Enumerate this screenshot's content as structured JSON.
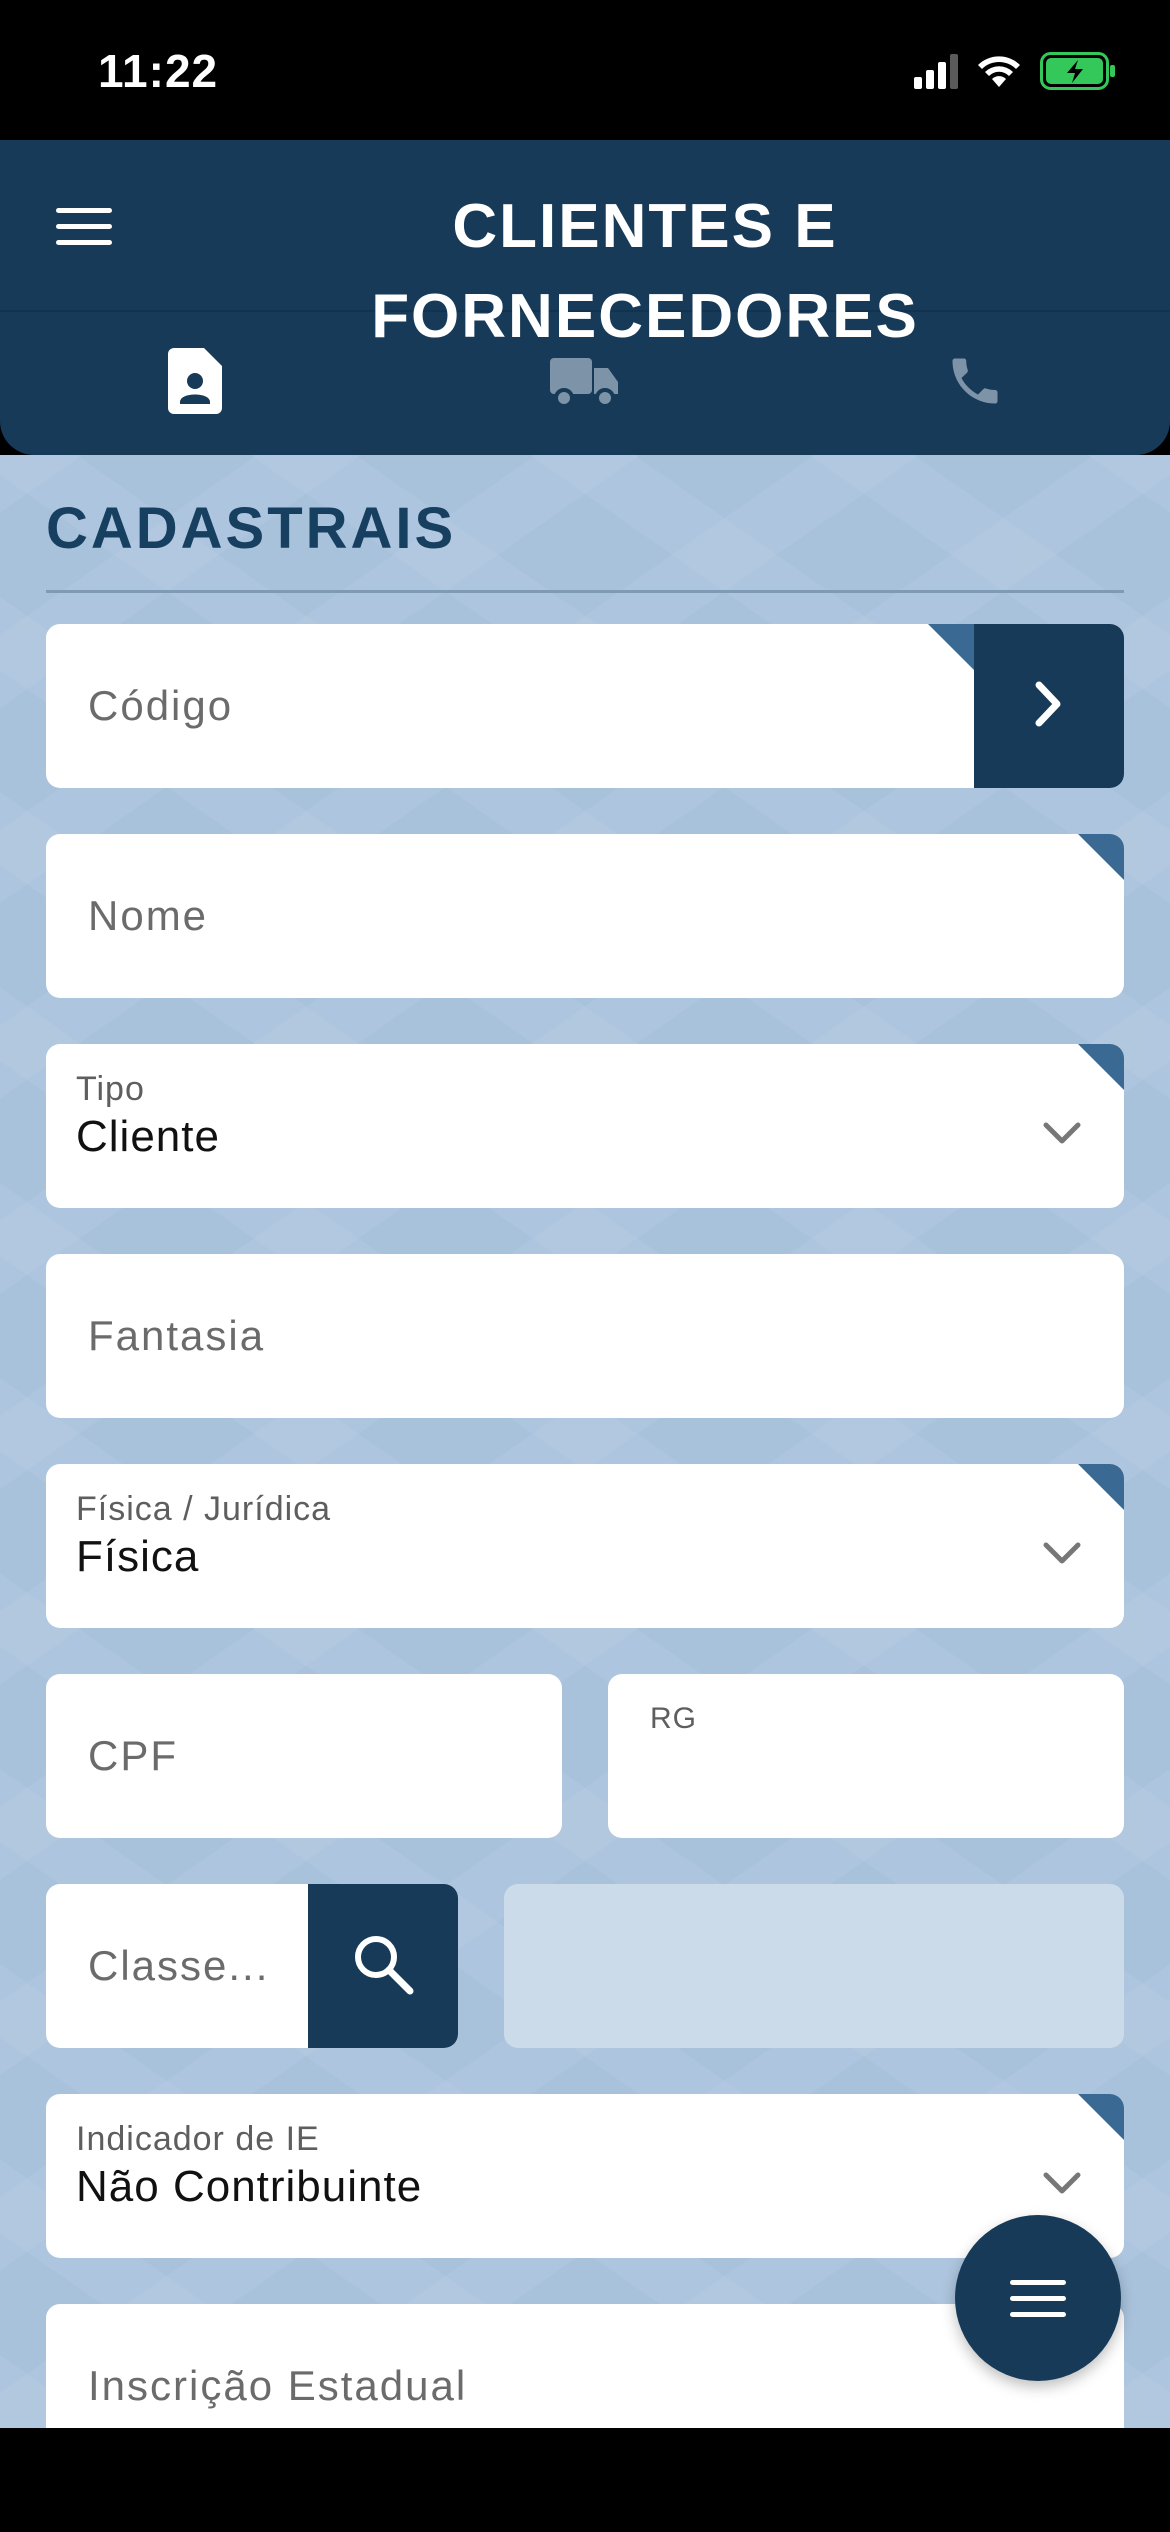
{
  "status_bar": {
    "time": "11:22"
  },
  "header": {
    "title": "CLIENTES E FORNECEDORES"
  },
  "section": {
    "title": "CADASTRAIS"
  },
  "form": {
    "codigo": {
      "placeholder": "Código"
    },
    "nome": {
      "placeholder": "Nome"
    },
    "tipo": {
      "label": "Tipo",
      "value": "Cliente"
    },
    "fantasia": {
      "placeholder": "Fantasia"
    },
    "pessoa": {
      "label": "Física / Jurídica",
      "value": "Física"
    },
    "cpf": {
      "placeholder": "CPF"
    },
    "rg": {
      "label": "RG"
    },
    "classe": {
      "placeholder": "Classe..."
    },
    "indicador_ie": {
      "label": "Indicador de IE",
      "value": "Não Contribuinte"
    },
    "inscricao_estadual": {
      "placeholder": "Inscrição Estadual"
    }
  },
  "icons": {
    "menu": "hamburger-icon",
    "tab_1": "contact-card-icon",
    "tab_2": "truck-icon",
    "tab_3": "phone-icon",
    "next": "chevron-right-icon",
    "search": "search-icon",
    "dropdown": "chevron-down-icon"
  },
  "colors": {
    "primary": "#163a57",
    "background": "#a9c2dc",
    "required_marker": "#3a6a93",
    "battery": "#34c759"
  }
}
